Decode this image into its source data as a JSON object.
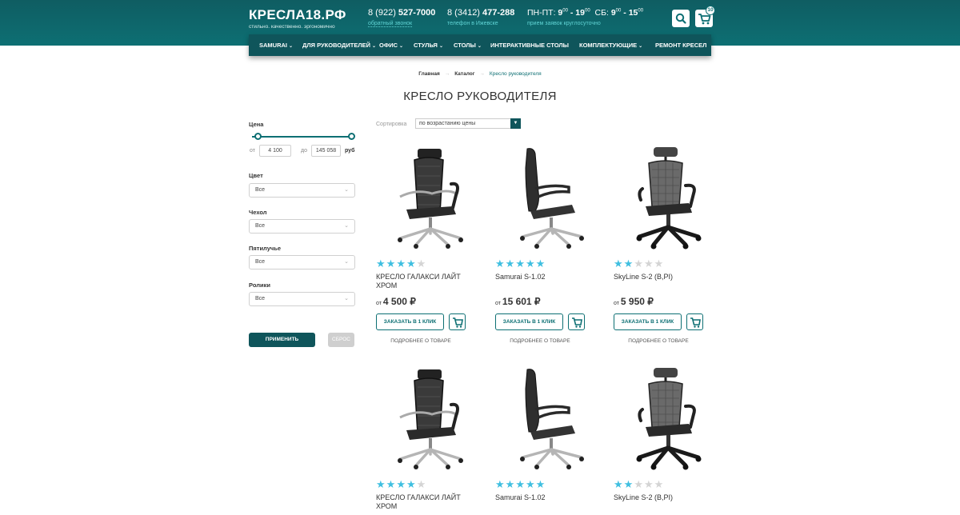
{
  "header": {
    "logo_title": "КРЕСЛА18.РФ",
    "logo_subtitle": "стильно. качественно. эргономично",
    "phone1_prefix": "8 (922) ",
    "phone1_number": "527-7000",
    "phone1_sub": "обратный звонок",
    "phone2_prefix": "8 (3412) ",
    "phone2_number": "477-288",
    "phone2_sub": "телефон в Ижевске",
    "hours_weekday_label": "ПН-ПТ: ",
    "hours_weekday_from": "9",
    "hours_weekday_to": "19",
    "hours_sat_label": "СБ: ",
    "hours_sat_from": "9",
    "hours_sat_to": "15",
    "hours_min": "00",
    "hours_sub": "прием заявок круглосуточно",
    "cart_count": "10"
  },
  "nav": {
    "items": [
      {
        "label": "SAMURAI"
      },
      {
        "label": "ДЛЯ РУКОВОДИТЕЛЕЙ"
      },
      {
        "label": "ОФИС"
      },
      {
        "label": "СТУЛЬЯ"
      },
      {
        "label": "СТОЛЫ"
      },
      {
        "label": "ИНТЕРАКТИВНЫЕ СТОЛЫ"
      },
      {
        "label": "КОМПЛЕКТУЮЩИЕ"
      },
      {
        "label": "РЕМОНТ КРЕСЕЛ"
      }
    ]
  },
  "breadcrumb": [
    "Главная",
    "Каталог",
    "Кресло руководителя"
  ],
  "page_title": "КРЕСЛО РУКОВОДИТЕЛЯ",
  "filters": {
    "price_label": "Цена",
    "from_label": "от",
    "from_value": "4 100",
    "to_label": "до",
    "to_value": "145 058",
    "currency": "руб",
    "color_label": "Цвет",
    "color_value": "Все",
    "cover_label": "Чехол",
    "cover_value": "Все",
    "base_label": "Пятилучье",
    "base_value": "Все",
    "wheels_label": "Ролики",
    "wheels_value": "Все",
    "apply_label": "ПРИМЕНИТЬ",
    "reset_label": "СБРОС"
  },
  "sort": {
    "label": "Сортировка",
    "value": "по возрастанию цены"
  },
  "products": [
    {
      "name": "КРЕСЛО ГАЛАКСИ ЛАЙТ ХРОМ",
      "price_prefix": "от ",
      "price": "4 500 ₽",
      "rating": 4,
      "order_label": "ЗАКАЗАТЬ В 1 КЛИК",
      "more_label": "ПОДРОБНЕЕ О ТОВАРЕ"
    },
    {
      "name": "Samurai S-1.02",
      "price_prefix": "от ",
      "price": "15 601 ₽",
      "rating": 5,
      "order_label": "ЗАКАЗАТЬ В 1 КЛИК",
      "more_label": "ПОДРОБНЕЕ О ТОВАРЕ"
    },
    {
      "name": "SkyLine S-2 (B,PI)",
      "price_prefix": "от ",
      "price": "5 950 ₽",
      "rating": 2,
      "order_label": "ЗАКАЗАТЬ В 1 КЛИК",
      "more_label": "ПОДРОБНЕЕ О ТОВАРЕ"
    },
    {
      "name": "КРЕСЛО ГАЛАКСИ ЛАЙТ ХРОМ",
      "rating": 4
    },
    {
      "name": "Samurai S-1.02",
      "rating": 5
    },
    {
      "name": "SkyLine S-2 (B,PI)",
      "rating": 2
    }
  ],
  "colors": {
    "header_bg": "#0d6f73",
    "nav_bg": "#0f555b",
    "accent": "#0d6f73",
    "star": "#3fbfe0"
  }
}
